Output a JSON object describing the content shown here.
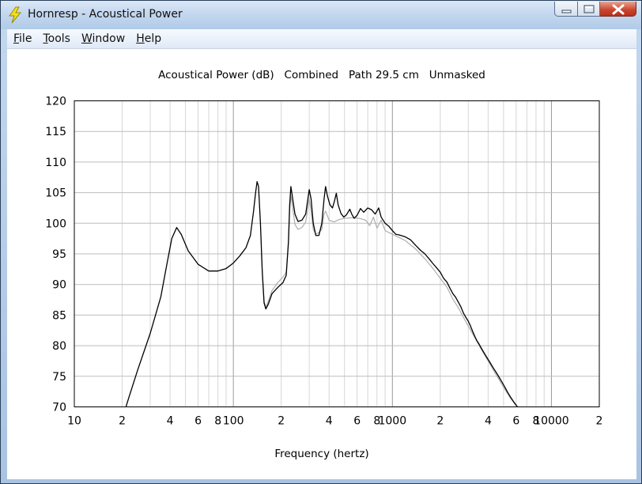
{
  "window": {
    "title": "Hornresp - Acoustical Power"
  },
  "menu": [
    {
      "label": "File",
      "accel": "F",
      "rest": "ile"
    },
    {
      "label": "Tools",
      "accel": "T",
      "rest": "ools"
    },
    {
      "label": "Window",
      "accel": "W",
      "rest": "indow"
    },
    {
      "label": "Help",
      "accel": "H",
      "rest": "elp"
    }
  ],
  "colors": {
    "primary_line": "#000000",
    "secondary_line": "#a8a8a8",
    "grid": "#bdbdbd"
  },
  "chart_data": {
    "type": "line",
    "title": "Acoustical Power (dB)   Combined   Path 29.5 cm   Unmasked",
    "xlabel": "Frequency (hertz)",
    "ylabel": "",
    "x_scale": "log",
    "xlim": [
      10,
      20000
    ],
    "ylim": [
      70,
      120
    ],
    "y_ticks": [
      "120",
      "115",
      "110",
      "105",
      "100",
      "95",
      "90",
      "85",
      "80",
      "75",
      "70"
    ],
    "x_ticks": [
      {
        "value": 10,
        "label": "10"
      },
      {
        "value": 20,
        "label": "2"
      },
      {
        "value": 40,
        "label": "4"
      },
      {
        "value": 60,
        "label": "6"
      },
      {
        "value": 80,
        "label": "8"
      },
      {
        "value": 100,
        "label": "100"
      },
      {
        "value": 200,
        "label": "2"
      },
      {
        "value": 400,
        "label": "4"
      },
      {
        "value": 600,
        "label": "6"
      },
      {
        "value": 800,
        "label": "8"
      },
      {
        "value": 1000,
        "label": "1000"
      },
      {
        "value": 2000,
        "label": "2"
      },
      {
        "value": 4000,
        "label": "4"
      },
      {
        "value": 6000,
        "label": "6"
      },
      {
        "value": 8000,
        "label": "8"
      },
      {
        "value": 10000,
        "label": "10000"
      },
      {
        "value": 20000,
        "label": "2"
      }
    ],
    "grid": true,
    "series": [
      {
        "style": "black",
        "points": [
          [
            20,
            68
          ],
          [
            22,
            71.5
          ],
          [
            25,
            76
          ],
          [
            30,
            82
          ],
          [
            35,
            88
          ],
          [
            38,
            93
          ],
          [
            41,
            97.5
          ],
          [
            44,
            99.3
          ],
          [
            47,
            98.2
          ],
          [
            52,
            95.5
          ],
          [
            60,
            93.3
          ],
          [
            70,
            92.2
          ],
          [
            80,
            92.2
          ],
          [
            90,
            92.6
          ],
          [
            100,
            93.5
          ],
          [
            110,
            94.7
          ],
          [
            120,
            96
          ],
          [
            128,
            98
          ],
          [
            134,
            102
          ],
          [
            138,
            105
          ],
          [
            141,
            106.8
          ],
          [
            144,
            106
          ],
          [
            148,
            100
          ],
          [
            152,
            92
          ],
          [
            156,
            87
          ],
          [
            160,
            86
          ],
          [
            166,
            86.8
          ],
          [
            175,
            88.5
          ],
          [
            190,
            89.5
          ],
          [
            205,
            90.3
          ],
          [
            215,
            91.5
          ],
          [
            222,
            97
          ],
          [
            226,
            103
          ],
          [
            230,
            106
          ],
          [
            236,
            104
          ],
          [
            244,
            101.5
          ],
          [
            255,
            100.3
          ],
          [
            270,
            100.5
          ],
          [
            285,
            101.5
          ],
          [
            300,
            105.5
          ],
          [
            308,
            104
          ],
          [
            318,
            100
          ],
          [
            330,
            98
          ],
          [
            345,
            98
          ],
          [
            360,
            100
          ],
          [
            372,
            104
          ],
          [
            380,
            106
          ],
          [
            390,
            104.5
          ],
          [
            405,
            103
          ],
          [
            420,
            102.5
          ],
          [
            432,
            103.6
          ],
          [
            444,
            104.9
          ],
          [
            456,
            103
          ],
          [
            475,
            101.6
          ],
          [
            495,
            101
          ],
          [
            515,
            101.4
          ],
          [
            540,
            102.3
          ],
          [
            555,
            101.5
          ],
          [
            575,
            100.8
          ],
          [
            600,
            101.3
          ],
          [
            630,
            102.4
          ],
          [
            660,
            101.8
          ],
          [
            700,
            102.5
          ],
          [
            740,
            102.2
          ],
          [
            780,
            101.5
          ],
          [
            820,
            102.5
          ],
          [
            850,
            101
          ],
          [
            900,
            100
          ],
          [
            950,
            99.5
          ],
          [
            1000,
            98.8
          ],
          [
            1050,
            98.2
          ],
          [
            1100,
            98.1
          ],
          [
            1200,
            97.8
          ],
          [
            1300,
            97.3
          ],
          [
            1400,
            96.4
          ],
          [
            1500,
            95.6
          ],
          [
            1600,
            95
          ],
          [
            1700,
            94.2
          ],
          [
            1800,
            93.4
          ],
          [
            1900,
            92.7
          ],
          [
            2000,
            92
          ],
          [
            2100,
            91
          ],
          [
            2200,
            90.4
          ],
          [
            2300,
            89.4
          ],
          [
            2400,
            88.5
          ],
          [
            2500,
            87.9
          ],
          [
            2600,
            87.1
          ],
          [
            2700,
            86.3
          ],
          [
            2800,
            85.3
          ],
          [
            2900,
            84.6
          ],
          [
            3000,
            84
          ],
          [
            3100,
            83.2
          ],
          [
            3200,
            82.3
          ],
          [
            3300,
            81.5
          ],
          [
            3400,
            80.8
          ],
          [
            3500,
            80.3
          ],
          [
            3700,
            79.2
          ],
          [
            3900,
            78.2
          ],
          [
            4100,
            77.3
          ],
          [
            4300,
            76.4
          ],
          [
            4500,
            75.6
          ],
          [
            4700,
            74.8
          ],
          [
            4900,
            74
          ],
          [
            5100,
            73.2
          ],
          [
            5300,
            72.4
          ],
          [
            5500,
            71.7
          ],
          [
            5800,
            70.8
          ],
          [
            6200,
            69.8
          ]
        ]
      },
      {
        "style": "gray",
        "points": [
          [
            150,
            95
          ],
          [
            156,
            87.3
          ],
          [
            160,
            86.3
          ],
          [
            166,
            87.3
          ],
          [
            175,
            89
          ],
          [
            190,
            90.3
          ],
          [
            205,
            91.2
          ],
          [
            215,
            92
          ],
          [
            222,
            96.5
          ],
          [
            226,
            102
          ],
          [
            230,
            104.5
          ],
          [
            236,
            102.5
          ],
          [
            244,
            99.8
          ],
          [
            255,
            99
          ],
          [
            270,
            99.3
          ],
          [
            285,
            100.2
          ],
          [
            300,
            104
          ],
          [
            308,
            102
          ],
          [
            318,
            99
          ],
          [
            330,
            98.2
          ],
          [
            345,
            98.5
          ],
          [
            360,
            99
          ],
          [
            372,
            101.5
          ],
          [
            380,
            102
          ],
          [
            400,
            100.5
          ],
          [
            430,
            100.2
          ],
          [
            460,
            100.6
          ],
          [
            500,
            100.8
          ],
          [
            560,
            100.9
          ],
          [
            620,
            100.8
          ],
          [
            680,
            100.5
          ],
          [
            720,
            99.6
          ],
          [
            760,
            101
          ],
          [
            800,
            99.2
          ],
          [
            850,
            100.5
          ],
          [
            900,
            98.8
          ],
          [
            1000,
            98.2
          ],
          [
            1200,
            97.2
          ],
          [
            1400,
            95.8
          ],
          [
            1600,
            94.2
          ],
          [
            1800,
            92.6
          ],
          [
            2000,
            91
          ],
          [
            2200,
            89.6
          ],
          [
            2400,
            87.6
          ],
          [
            2600,
            86.2
          ],
          [
            2800,
            84.6
          ],
          [
            3000,
            83.2
          ],
          [
            3300,
            81.3
          ],
          [
            3600,
            79.5
          ],
          [
            4000,
            77.5
          ],
          [
            4500,
            75.2
          ],
          [
            5000,
            73.2
          ],
          [
            5500,
            71.5
          ],
          [
            6000,
            70.2
          ]
        ]
      }
    ]
  }
}
